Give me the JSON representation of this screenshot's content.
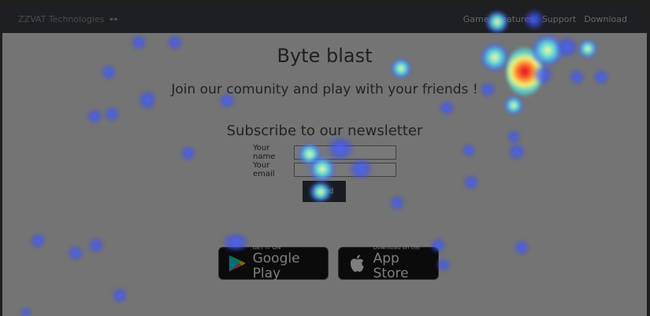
{
  "navbar": {
    "brand": "ZZVAT Technologies",
    "brand_icon": "glasses-icon",
    "links": [
      "Game",
      "Features",
      "Support",
      "Download"
    ]
  },
  "hero": {
    "title": "Byte blast",
    "subtitle": "Join our comunity and play with your friends !"
  },
  "newsletter": {
    "heading": "Subscribe to our newsletter",
    "name_label": "Your name",
    "email_label": "Your email",
    "send_label": "Send"
  },
  "badges": {
    "google_small": "GET IT ON",
    "google_big": "Google Play",
    "apple_small": "Download on the",
    "apple_big": "App Store"
  },
  "colors": {
    "navbar_bg": "#2a2e33",
    "page_bg": "#e9e9e9",
    "button_bg": "#1d2733"
  }
}
